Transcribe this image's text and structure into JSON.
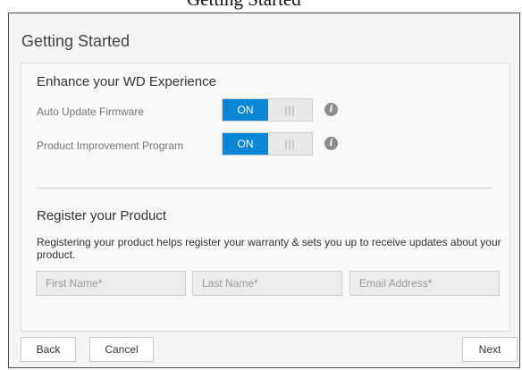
{
  "page": {
    "header_text": "Getting Started"
  },
  "dialog": {
    "title": "Getting Started",
    "experience": {
      "title": "Enhance your WD Experience",
      "settings": [
        {
          "label": "Auto Update Firmware",
          "state": "ON",
          "grip": "|||",
          "info_icon": "info-icon"
        },
        {
          "label": "Product Improvement Program",
          "state": "ON",
          "grip": "|||",
          "info_icon": "info-icon"
        }
      ]
    },
    "register": {
      "title": "Register your Product",
      "description": "Registering your product helps register your warranty & sets you up to receive updates about your product.",
      "first_name": {
        "placeholder": "First Name*",
        "value": ""
      },
      "last_name": {
        "placeholder": "Last Name*",
        "value": ""
      },
      "email": {
        "placeholder": "Email Address*",
        "value": ""
      }
    },
    "footer": {
      "back_label": "Back",
      "cancel_label": "Cancel",
      "next_label": "Next"
    }
  },
  "colors": {
    "toggle_on": "#0a87d6",
    "info_icon": "#8c8c8c",
    "panel_background": "#f4f4f4"
  }
}
